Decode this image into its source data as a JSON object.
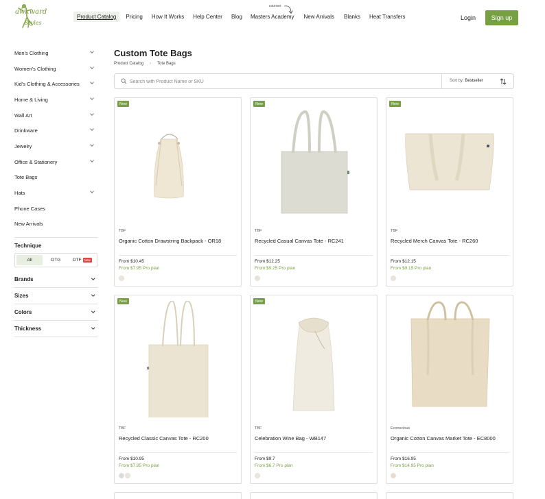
{
  "header": {
    "logo_text_top": "awkward",
    "logo_text_bottom": "Styles",
    "nav": [
      {
        "label": "Product Catalog",
        "active": true
      },
      {
        "label": "Pricing"
      },
      {
        "label": "How It Works"
      },
      {
        "label": "Help Center"
      },
      {
        "label": "Blog"
      },
      {
        "label": "Masters Academy"
      },
      {
        "label": "New Arrivals"
      },
      {
        "label": "Blanks"
      },
      {
        "label": "Heat Transfers"
      }
    ],
    "courses_note": "courses",
    "login": "Login",
    "signup": "Sign up",
    "accent_color": "#77a043"
  },
  "sidebar": {
    "categories": [
      {
        "label": "Men's Clothing",
        "expandable": true
      },
      {
        "label": "Women's Clothing",
        "expandable": true
      },
      {
        "label": "Kid's Clothing & Accessories",
        "expandable": true
      },
      {
        "label": "Home & Living",
        "expandable": true
      },
      {
        "label": "Wall Art",
        "expandable": true
      },
      {
        "label": "Drinkware",
        "expandable": true
      },
      {
        "label": "Jewelry",
        "expandable": true
      },
      {
        "label": "Office & Stationery",
        "expandable": true
      },
      {
        "label": "Tote Bags",
        "expandable": false
      },
      {
        "label": "Hats",
        "expandable": true
      },
      {
        "label": "Phone Cases",
        "expandable": false
      },
      {
        "label": "New Arrivals",
        "expandable": false
      }
    ],
    "technique": {
      "title": "Technique",
      "options": [
        "All",
        "DTG",
        "DTF"
      ],
      "selected": "All",
      "new_tag": "New"
    },
    "filters": [
      "Brands",
      "Sizes",
      "Colors",
      "Thickness"
    ]
  },
  "main": {
    "title": "Custom Tote Bags",
    "breadcrumb": [
      "Product Catalog",
      "Tote Bags"
    ],
    "search_placeholder": "Search with Product Name or SKU",
    "sort_label": "Sort by:",
    "sort_value": "Bestseller",
    "new_badge": "New",
    "products": [
      {
        "brand": "TBF",
        "name": "Organic Cotton Drawstring Backpack  - OR18",
        "price": "From $10.45",
        "pro": "From $7.95 Pro plan",
        "new": true,
        "shape": "backpack",
        "swatches": [
          "#efe6d2"
        ]
      },
      {
        "brand": "TBF",
        "name": "Recycled Casual Canvas Tote  - RC241",
        "price": "From $12.25",
        "pro": "From $9.25 Pro plan",
        "new": true,
        "shape": "tote-grey",
        "swatches": [
          "#ebe4d3"
        ]
      },
      {
        "brand": "TBF",
        "name": "Recycled Merch Canvas Tote  - RC260",
        "price": "From $12.15",
        "pro": "From $9.15 Pro plan",
        "new": true,
        "shape": "tote-wide",
        "swatches": [
          "#ebe4d3"
        ]
      },
      {
        "brand": "TBF",
        "name": "Recycled Classic Canvas Tote  - RC200",
        "price": "From $10.95",
        "pro": "From $7.95 Pro plan",
        "new": true,
        "shape": "tote-tall",
        "swatches": [
          "#d9d9d9",
          "#efe6d2"
        ]
      },
      {
        "brand": "TBF",
        "name": "Celebration Wine Bag  - WB147",
        "price": "From $9.7",
        "pro": "From $6.7 Pro plan",
        "new": true,
        "shape": "wine",
        "swatches": [
          "#efe6d2"
        ]
      },
      {
        "brand": "Econscious",
        "name": "Organic Cotton Canvas Market Tote  - EC8000",
        "price": "From $16.95",
        "pro": "From $14.95 Pro plan",
        "new": false,
        "shape": "market",
        "swatches": [
          "#ecdcc4"
        ]
      }
    ]
  }
}
